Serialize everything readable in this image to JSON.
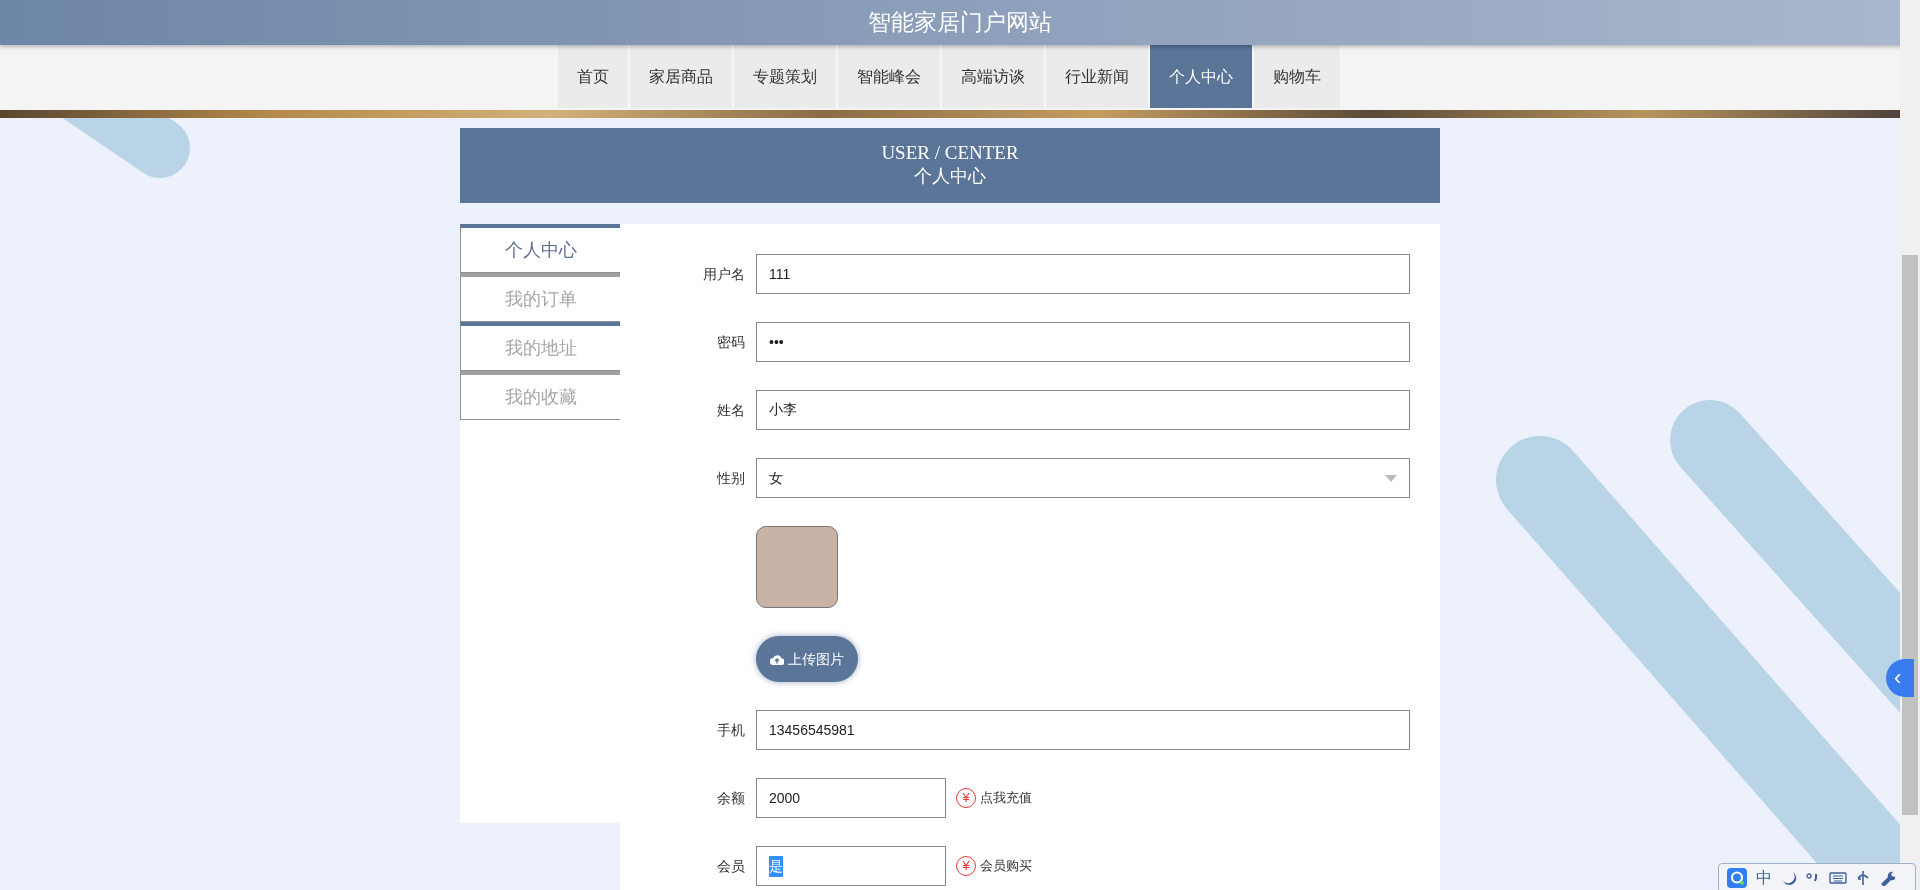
{
  "site_title": "智能家居门户网站",
  "nav": [
    {
      "label": "首页",
      "selected": false
    },
    {
      "label": "家居商品",
      "selected": false
    },
    {
      "label": "专题策划",
      "selected": false
    },
    {
      "label": "智能峰会",
      "selected": false
    },
    {
      "label": "高端访谈",
      "selected": false
    },
    {
      "label": "行业新闻",
      "selected": false
    },
    {
      "label": "个人中心",
      "selected": true
    },
    {
      "label": "购物车",
      "selected": false
    }
  ],
  "section_header": {
    "title_en": "USER / CENTER",
    "title_zh": "个人中心"
  },
  "sidebar": {
    "items": [
      {
        "label": "个人中心",
        "selected": true,
        "hovered": false
      },
      {
        "label": "我的订单",
        "selected": false,
        "hovered": false
      },
      {
        "label": "我的地址",
        "selected": false,
        "hovered": true
      },
      {
        "label": "我的收藏",
        "selected": false,
        "hovered": false
      }
    ]
  },
  "form": {
    "fields": [
      {
        "kind": "text",
        "label": "用户名",
        "value": "111"
      },
      {
        "kind": "text",
        "label": "密码",
        "value": "•••"
      },
      {
        "kind": "text",
        "label": "姓名",
        "value": "小李"
      },
      {
        "kind": "select",
        "label": "性别",
        "value": "女"
      },
      {
        "kind": "avatar"
      },
      {
        "kind": "upload",
        "button": "上传图片"
      },
      {
        "kind": "text",
        "label": "手机",
        "value": "13456545981"
      },
      {
        "kind": "short",
        "label": "余额",
        "value": "2000",
        "text_selected": false,
        "action_symbol": "¥",
        "action": "点我充值"
      },
      {
        "kind": "short",
        "label": "会员",
        "value": "是",
        "text_selected": true,
        "action_symbol": "¥",
        "action": "会员购买"
      }
    ]
  },
  "side_tab": {
    "symbol": "‹"
  },
  "ime_toolbar": {
    "mode": "中"
  }
}
